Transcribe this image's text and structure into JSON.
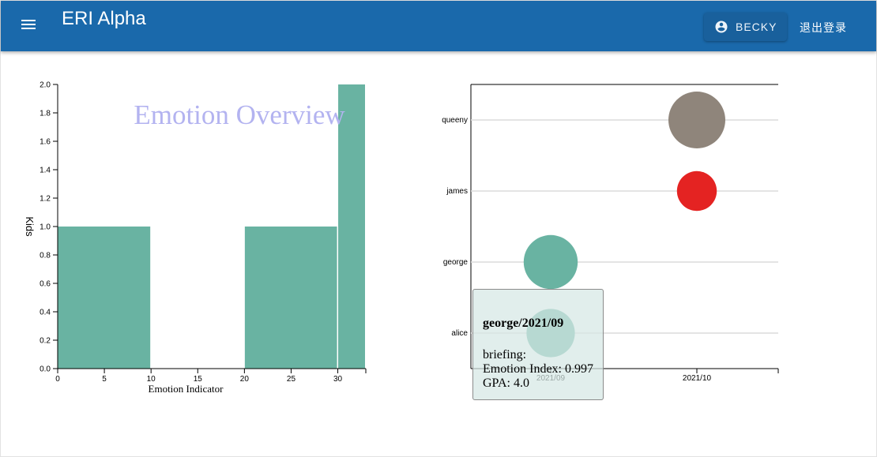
{
  "app": {
    "title": "ERI Alpha",
    "user_name": "BECKY",
    "logout_label": "退出登录"
  },
  "icons": {
    "menu": "menu-icon",
    "user": "account-circle-icon"
  },
  "colors": {
    "app_bar": "#1a69ab",
    "histogram_bar": "#69b3a2",
    "chart_title": "#b3b3f0"
  },
  "histogram": {
    "chart_data": {
      "type": "bar",
      "title": "Emotion Overview",
      "xlabel": "Emotion Indicator",
      "ylabel": "Kids",
      "xlim": [
        0,
        33
      ],
      "ylim": [
        0,
        2
      ],
      "x_ticks": [
        "0",
        "5",
        "10",
        "15",
        "20",
        "25",
        "30"
      ],
      "y_ticks": [
        "0.0",
        "0.2",
        "0.4",
        "0.6",
        "0.8",
        "1.0",
        "1.2",
        "1.4",
        "1.6",
        "1.8",
        "2.0"
      ],
      "bins": [
        {
          "x0": 0,
          "x1": 10,
          "value": 1
        },
        {
          "x0": 10,
          "x1": 20,
          "value": 0
        },
        {
          "x0": 20,
          "x1": 30,
          "value": 1
        },
        {
          "x0": 30,
          "x1": 33,
          "value": 2
        }
      ]
    }
  },
  "bubble": {
    "chart_data": {
      "type": "scatter",
      "categories_y": [
        "queeny",
        "james",
        "george",
        "alice"
      ],
      "x_ticks": [
        "2021/09",
        "2021/10"
      ],
      "points": [
        {
          "student": "queeny",
          "month": "2021/10",
          "color": "#8f857b",
          "size": 1.0
        },
        {
          "student": "james",
          "month": "2021/10",
          "color": "#e42322",
          "size": 0.7
        },
        {
          "student": "george",
          "month": "2021/09",
          "color": "#69b3a2",
          "size": 0.95
        },
        {
          "student": "alice",
          "month": "2021/09",
          "color": "#69b3a2",
          "size": 0.85
        }
      ]
    }
  },
  "tooltip": {
    "title": "george/2021/09",
    "briefing_label": "briefing:",
    "emotion_index": "Emotion Index: 0.997",
    "gpa": "GPA: 4.0"
  }
}
